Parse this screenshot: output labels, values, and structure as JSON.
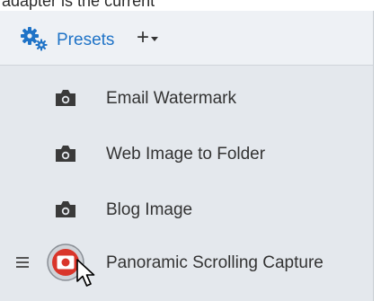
{
  "top_strip_text": "adapter is the current",
  "header": {
    "gear_icon": "gear-icon",
    "title": "Presets",
    "add_symbol": "+",
    "accent_color": "#1f73c7"
  },
  "presets": [
    {
      "label": "Email Watermark",
      "icon": "camera-icon"
    },
    {
      "label": "Web Image to Folder",
      "icon": "camera-icon"
    },
    {
      "label": "Blog Image",
      "icon": "camera-icon"
    },
    {
      "label": "Panoramic Scrolling Capture",
      "icon": "record-icon",
      "active": true
    }
  ],
  "colors": {
    "record_red": "#d9352a",
    "panel_bg": "#e4e8ed"
  }
}
